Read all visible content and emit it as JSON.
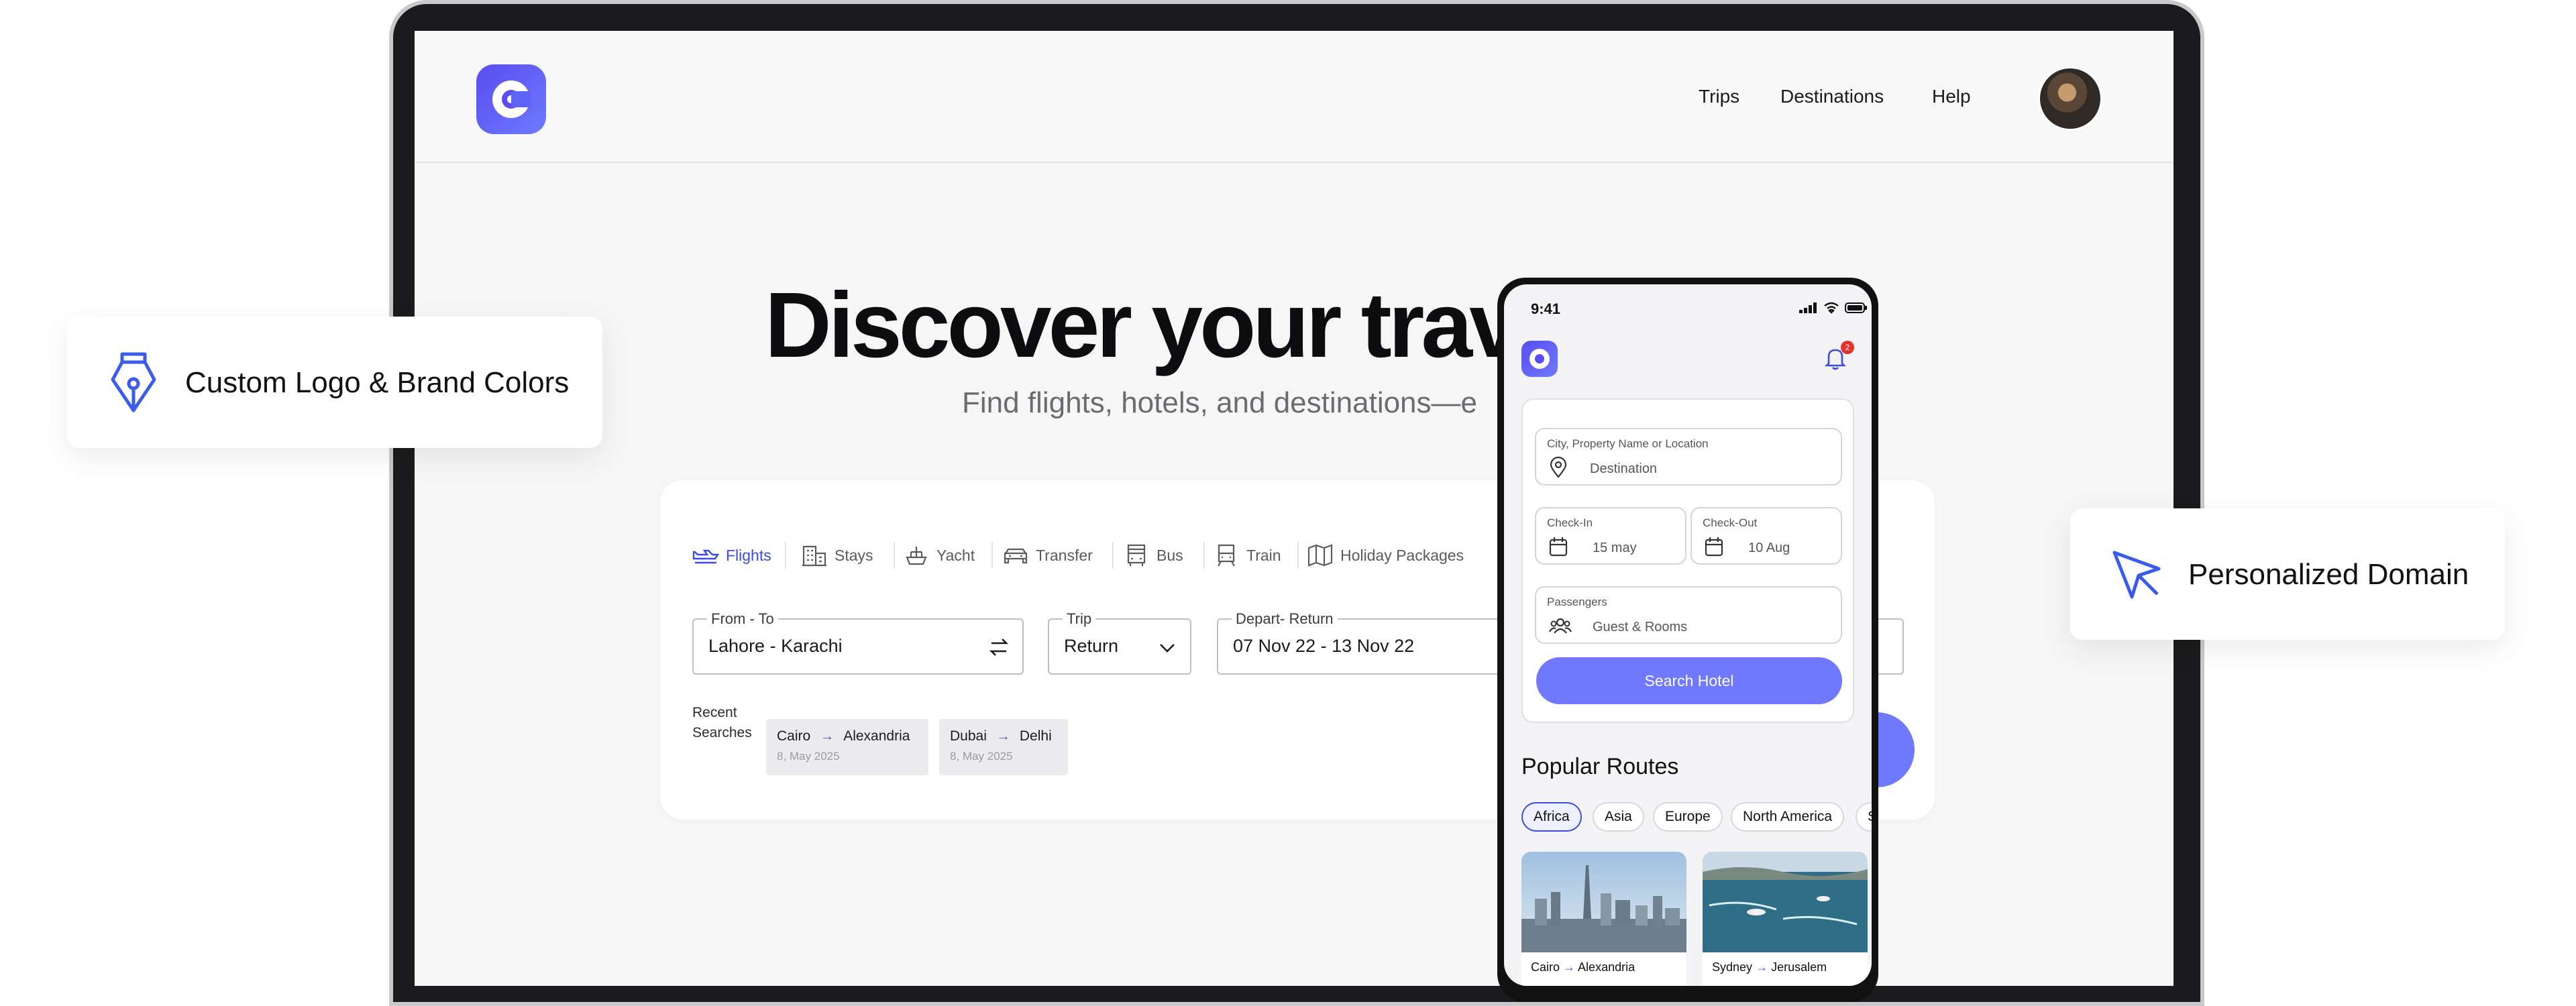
{
  "nav": {
    "links": [
      "Trips",
      "Destinations",
      "Help"
    ]
  },
  "hero": {
    "title": "Discover your trave",
    "subtitle": "Find flights, hotels, and destinations—e"
  },
  "search": {
    "tabs": [
      "Flights",
      "Stays",
      "Yacht",
      "Transfer",
      "Bus",
      "Train",
      "Holiday Packages"
    ],
    "from_to_label": "From - To",
    "from_to_value": "Lahore - Karachi",
    "trip_label": "Trip",
    "trip_value": "Return",
    "dates_label": "Depart- Return",
    "dates_value": "07 Nov 22 - 13 Nov 22",
    "recent_label": "Recent Searches",
    "recent": [
      {
        "from": "Cairo",
        "to": "Alexandria",
        "date": "8, May 2025"
      },
      {
        "from": "Dubai",
        "to": "Delhi",
        "date": "8, May 2025"
      }
    ]
  },
  "phone": {
    "time": "9:41",
    "badge_count": "2",
    "destination_label": "City, Property Name or Location",
    "destination_placeholder": "Destination",
    "checkin_label": "Check-In",
    "checkin_value": "15 may",
    "checkout_label": "Check-Out",
    "checkout_value": "10 Aug",
    "passengers_label": "Passengers",
    "passengers_value": "Guest & Rooms",
    "search_button": "Search Hotel",
    "popular_title": "Popular Routes",
    "regions": [
      "Africa",
      "Asia",
      "Europe",
      "North America",
      "S"
    ],
    "routes": [
      {
        "from": "Cairo",
        "to": "Alexandria"
      },
      {
        "from": "Sydney",
        "to": "Jerusalem"
      }
    ]
  },
  "features": {
    "left": "Custom Logo & Brand Colors",
    "right": "Personalized Domain"
  },
  "colors": {
    "accent": "#6f78ff",
    "brand": "#5a4cf0",
    "active_tab": "#3b4be0"
  }
}
